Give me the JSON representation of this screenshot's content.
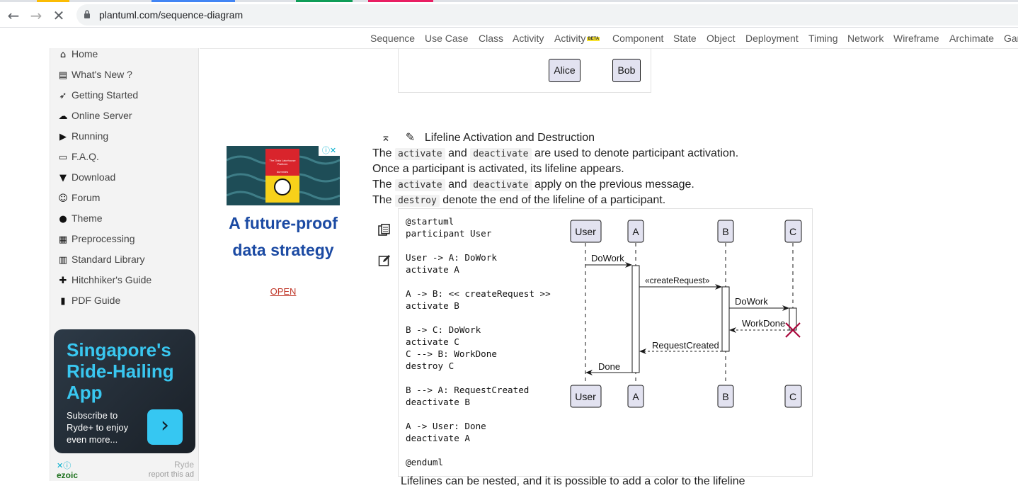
{
  "browser": {
    "url": "plantuml.com/sequence-diagram",
    "tab_colors": [
      "#fbbc04",
      "#4285f4",
      "#0f9d58",
      "#e91e63"
    ]
  },
  "topnav": {
    "items": [
      "Sequence",
      "Use Case",
      "Class",
      "Activity",
      "Activity",
      "Component",
      "State",
      "Object",
      "Deployment",
      "Timing",
      "Network",
      "Wireframe",
      "Archimate",
      "Gan"
    ],
    "beta_badge": "BETA"
  },
  "sidebar": {
    "items": [
      {
        "label": "Home",
        "icon": "home-icon"
      },
      {
        "label": "What's New ?",
        "icon": "document-icon"
      },
      {
        "label": "Getting Started",
        "icon": "rocket-icon"
      },
      {
        "label": "Online Server",
        "icon": "cloud-icon"
      },
      {
        "label": "Running",
        "icon": "play-icon"
      },
      {
        "label": "F.A.Q.",
        "icon": "chat-icon"
      },
      {
        "label": "Download",
        "icon": "download-basket-icon"
      },
      {
        "label": "Forum",
        "icon": "people-icon"
      },
      {
        "label": "Theme",
        "icon": "palette-icon"
      },
      {
        "label": "Preprocessing",
        "icon": "chip-icon"
      },
      {
        "label": "Standard Library",
        "icon": "library-icon"
      },
      {
        "label": "Hitchhiker's Guide",
        "icon": "signpost-icon"
      },
      {
        "label": "PDF Guide",
        "icon": "book-icon"
      }
    ]
  },
  "ads": {
    "ad1": {
      "headline_line1": "A future-proof",
      "headline_line2": "data strategy",
      "cta": "OPEN",
      "book_text": "The Data Lakehouse Platform",
      "book_brand": "dummies"
    },
    "ad2": {
      "headline": "Singapore's Ride-Hailing App",
      "subtext": "Subscribe to Ryde+ to enjoy even more...",
      "brand": "Ryde",
      "report": "report this ad",
      "network": "ezoic"
    }
  },
  "previous_diagram": {
    "participants": [
      "Alice",
      "Bob"
    ]
  },
  "section": {
    "title": "Lifeline Activation and Destruction",
    "lines": [
      {
        "pre": "The ",
        "code1": "activate",
        "mid": " and ",
        "code2": "deactivate",
        "post": " are used to denote participant activation."
      },
      {
        "text": "Once a participant is activated, its lifeline appears."
      },
      {
        "pre": "The ",
        "code1": "activate",
        "mid": " and ",
        "code2": "deactivate",
        "post": " apply on the previous message."
      },
      {
        "pre": "The ",
        "code1": "destroy",
        "post": " denote the end of the lifeline of a participant."
      }
    ],
    "bottom_cutoff": "Lifelines can be nested, and it is possible to add a color to the lifeline"
  },
  "code": "@startuml\nparticipant User\n\nUser -> A: DoWork\nactivate A\n\nA -> B: << createRequest >>\nactivate B\n\nB -> C: DoWork\nactivate C\nC --> B: WorkDone\ndestroy C\n\nB --> A: RequestCreated\ndeactivate B\n\nA -> User: Done\ndeactivate A\n\n@enduml",
  "sequence": {
    "participants": [
      "User",
      "A",
      "B",
      "C"
    ],
    "messages": [
      {
        "from": "User",
        "to": "A",
        "label": "DoWork",
        "dashed": false
      },
      {
        "from": "A",
        "to": "B",
        "label": "«createRequest»",
        "dashed": false
      },
      {
        "from": "B",
        "to": "C",
        "label": "DoWork",
        "dashed": false
      },
      {
        "from": "C",
        "to": "B",
        "label": "WorkDone",
        "dashed": true
      },
      {
        "from": "B",
        "to": "A",
        "label": "RequestCreated",
        "dashed": true
      },
      {
        "from": "A",
        "to": "User",
        "label": "Done",
        "dashed": false
      }
    ]
  }
}
